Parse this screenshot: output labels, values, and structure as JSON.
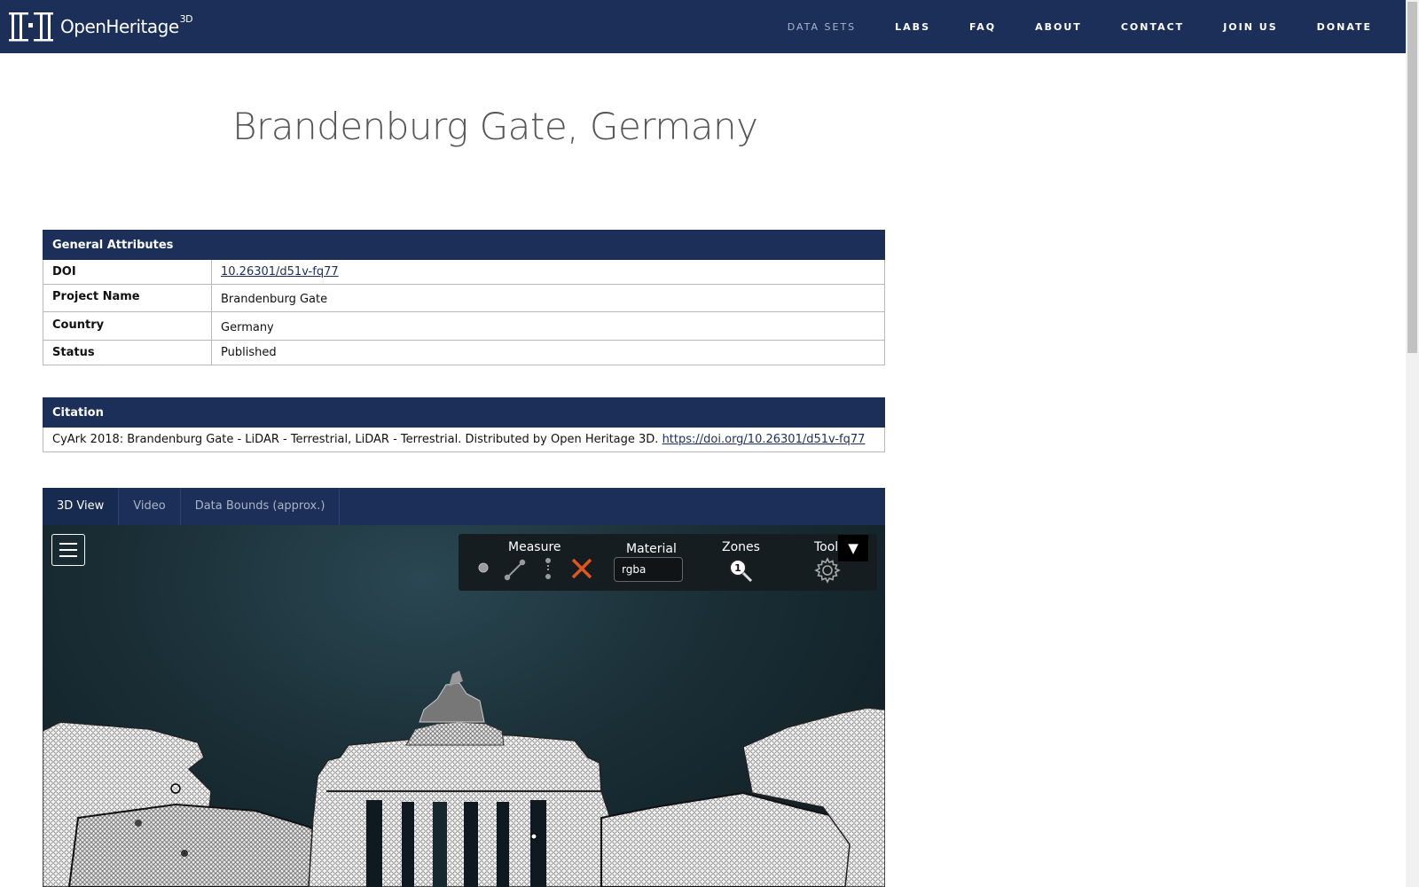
{
  "brand": {
    "name": "OpenHeritage",
    "sup": "3D"
  },
  "nav": {
    "items": [
      {
        "label": "DATA SETS"
      },
      {
        "label": "LABS"
      },
      {
        "label": "FAQ"
      },
      {
        "label": "ABOUT"
      },
      {
        "label": "CONTACT"
      },
      {
        "label": "JOIN US"
      },
      {
        "label": "DONATE"
      }
    ]
  },
  "page": {
    "title": "Brandenburg Gate, Germany"
  },
  "general": {
    "header": "General Attributes",
    "rows": [
      {
        "key": "DOI",
        "value": "10.26301/d51v-fq77"
      },
      {
        "key": "Project Name",
        "value": "Brandenburg Gate"
      },
      {
        "key": "Country",
        "value": "Germany"
      },
      {
        "key": "Status",
        "value": "Published"
      }
    ]
  },
  "citation": {
    "header": "Citation",
    "text": "CyArk 2018: Brandenburg Gate - LiDAR - Terrestrial, LiDAR - Terrestrial. Distributed by Open Heritage 3D. ",
    "link": "https://doi.org/10.26301/d51v-fq77"
  },
  "viewer": {
    "tabs": [
      {
        "label": "3D View"
      },
      {
        "label": "Video"
      },
      {
        "label": "Data Bounds (approx.)"
      }
    ],
    "toolbar": {
      "measure_label": "Measure",
      "material_label": "Material",
      "material_value": "rgba",
      "zones_label": "Zones",
      "zones_badge": "1",
      "tools_label": "Tools",
      "collapse_glyph": "▼"
    }
  },
  "colors": {
    "navy": "#1b2f58",
    "delete_x": "#e0561b"
  },
  "icons": [
    "menu-icon",
    "point-icon",
    "distance-icon",
    "height-icon",
    "delete-icon",
    "zoom-icon",
    "gear-icon"
  ]
}
